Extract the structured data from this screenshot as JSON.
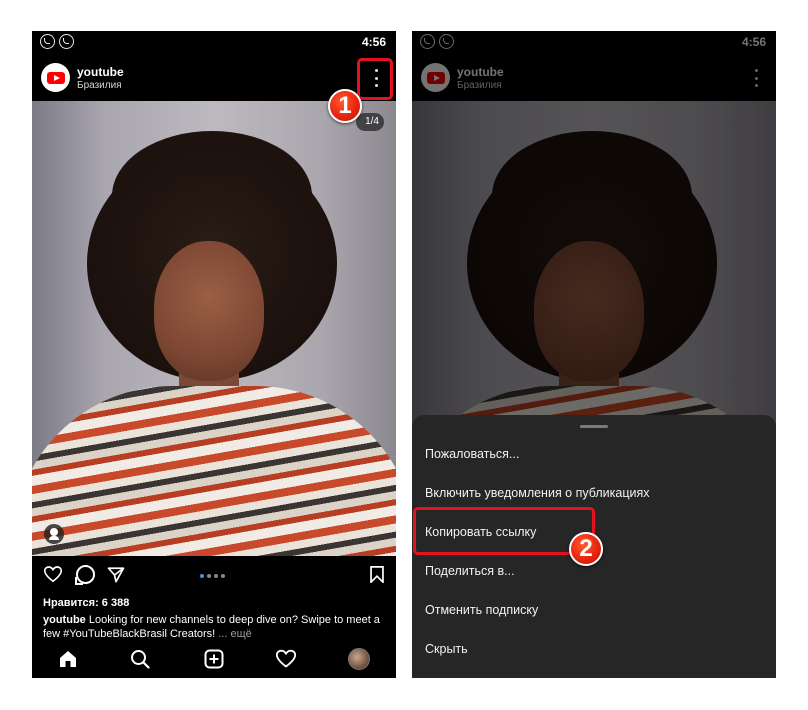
{
  "status_bar": {
    "time": "4:56",
    "icons": [
      "viber-icon",
      "whatsapp-icon"
    ]
  },
  "post": {
    "account_name": "youtube",
    "location": "Бразилия",
    "image_counter": "1/4",
    "likes": "Нравится: 6 388",
    "caption_user": "youtube",
    "caption_text": "Looking for new channels to deep dive on? Swipe to meet a few #YouTubeBlackBrasil Creators!",
    "caption_more": "... ещё"
  },
  "menu": {
    "items": [
      "Пожаловаться...",
      "Включить уведомления о публикациях",
      "Копировать ссылку",
      "Поделиться в...",
      "Отменить подписку",
      "Скрыть"
    ]
  },
  "annotations": {
    "step1": "1",
    "step2": "2",
    "color": "#e3121f"
  },
  "colors": {
    "background": "#000000",
    "sheet": "#262626",
    "accent_dot": "#3897f0",
    "youtube_red": "#ff0000"
  }
}
